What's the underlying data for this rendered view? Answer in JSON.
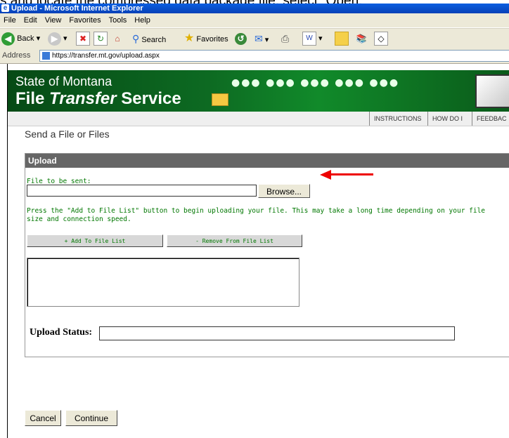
{
  "caption": "s and locate the compressed data package file, select “Open.”",
  "window": {
    "title": "Upload - Microsoft Internet Explorer"
  },
  "menu": [
    "File",
    "Edit",
    "View",
    "Favorites",
    "Tools",
    "Help"
  ],
  "toolbar": {
    "back": "Back",
    "search": "Search",
    "favorites": "Favorites"
  },
  "address": {
    "label": "Address",
    "url": "https://transfer.mt.gov/upload.aspx"
  },
  "banner": {
    "line1": "State of Montana",
    "line2_a": "File ",
    "line2_b": "Transfer",
    "line2_c": " Service"
  },
  "nav": [
    "INSTRUCTIONS",
    "HOW DO I",
    "FEEDBAC"
  ],
  "page": {
    "heading": "Send a File or Files",
    "panel_title": "Upload",
    "file_label": "File to be sent:",
    "browse": "Browse...",
    "instruction": "Press the \"Add to File List\" button to begin uploading your file. This may take a long time depending on your file size and connection speed.",
    "add_button": "+ Add To File List",
    "remove_button": "- Remove From File List",
    "status_label": "Upload Status:",
    "cancel": "Cancel",
    "continue": "Continue"
  },
  "colors": {
    "banner_green": "#0d6a22",
    "panel_header": "#666666",
    "hint_text": "#007700",
    "arrow": "#e00000"
  }
}
